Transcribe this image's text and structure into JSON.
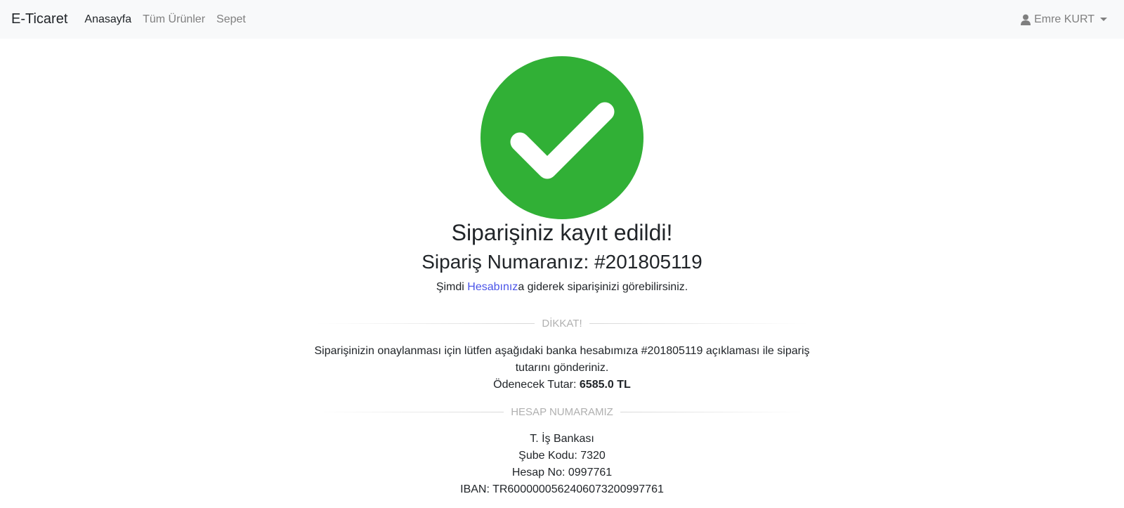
{
  "navbar": {
    "brand": "E-Ticaret",
    "links": [
      "Anasayfa",
      "Tüm Ürünler",
      "Sepet"
    ],
    "user": "Emre KURT",
    "user_icon": "user-icon"
  },
  "success": {
    "icon": "check-circle-icon",
    "color": "#31b036",
    "title": "Siparişiniz kayıt edildi!",
    "order_prefix": "Sipariş Numaranız: ",
    "order_number": "#201805119",
    "info_before": "Şimdi ",
    "info_link": "Hesabınız",
    "info_after": "a giderek siparişinizi görebilirsiniz."
  },
  "notice": {
    "heading": "DİKKAT!",
    "message": "Siparişinizin onaylanması için lütfen aşağıdaki banka hesabımıza #201805119 açıklaması ile sipariş tutarını gönderiniz.",
    "amount_label": "Ödenecek Tutar: ",
    "amount_value": "6585.0 TL"
  },
  "bank": {
    "heading": "HESAP NUMARAMIZ",
    "name": "T. İş Bankası",
    "branch": "Şube Kodu: 7320",
    "account": "Hesap No: 0997761",
    "iban": "IBAN: TR600000056240607320099776​1"
  }
}
